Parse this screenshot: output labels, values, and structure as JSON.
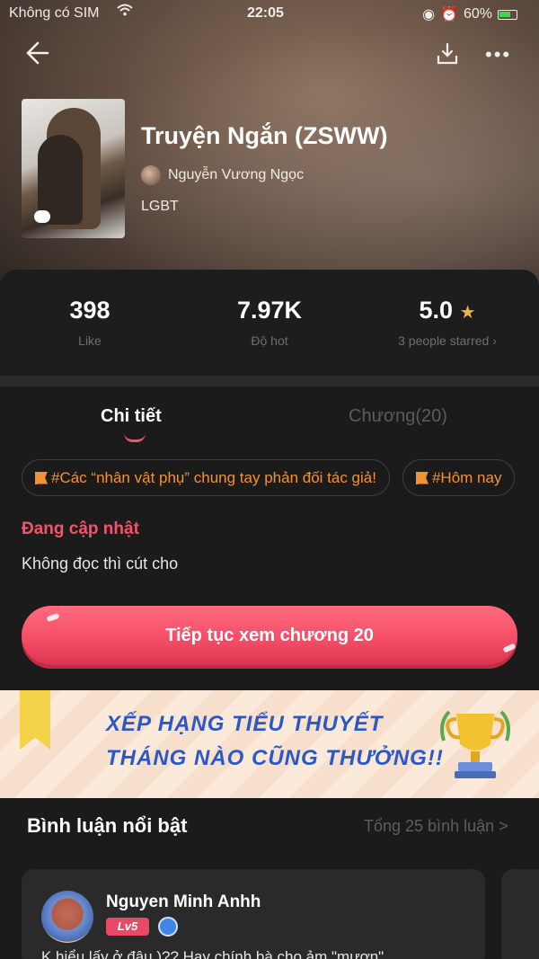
{
  "status_bar": {
    "carrier": "Không có SIM",
    "time": "22:05",
    "battery": "60%"
  },
  "book": {
    "title": "Truyện Ngắn (ZSWW)",
    "author": "Nguyễn Vương Ngọc",
    "genre": "LGBT"
  },
  "stats": {
    "likes_value": "398",
    "likes_label": "Like",
    "hot_value": "7.97K",
    "hot_label": "Độ hot",
    "rating_value": "5.0",
    "rating_label": "3 people starred"
  },
  "tabs": {
    "details": "Chi tiết",
    "chapters": "Chương(20)"
  },
  "tags": [
    "#Các “nhân vật phụ” chung tay phản đối tác giả!",
    "#Hôm nay"
  ],
  "update_status": "Đang cập nhật",
  "description": "Không đọc thì cút cho",
  "cta_label": "Tiếp tục xem chương 20",
  "banner": {
    "line1": "XẾP HẠNG TIỂU THUYẾT",
    "line2": "THÁNG NÀO CŨNG THƯỞNG!!"
  },
  "comments": {
    "section_title": "Bình luận nổi bật",
    "total_link": "Tổng 25 bình luận >",
    "first": {
      "name": "Nguyen Minh Anhh",
      "level": "Lv5",
      "text": "K hiểu lấy ở đâu )?? Hay chính bà cho ảm \"mượn\""
    }
  },
  "colors": {
    "accent_pink": "#f0566b",
    "tag_orange": "#f19233",
    "banner_blue": "#2b58c8",
    "star": "#f6b23c"
  }
}
